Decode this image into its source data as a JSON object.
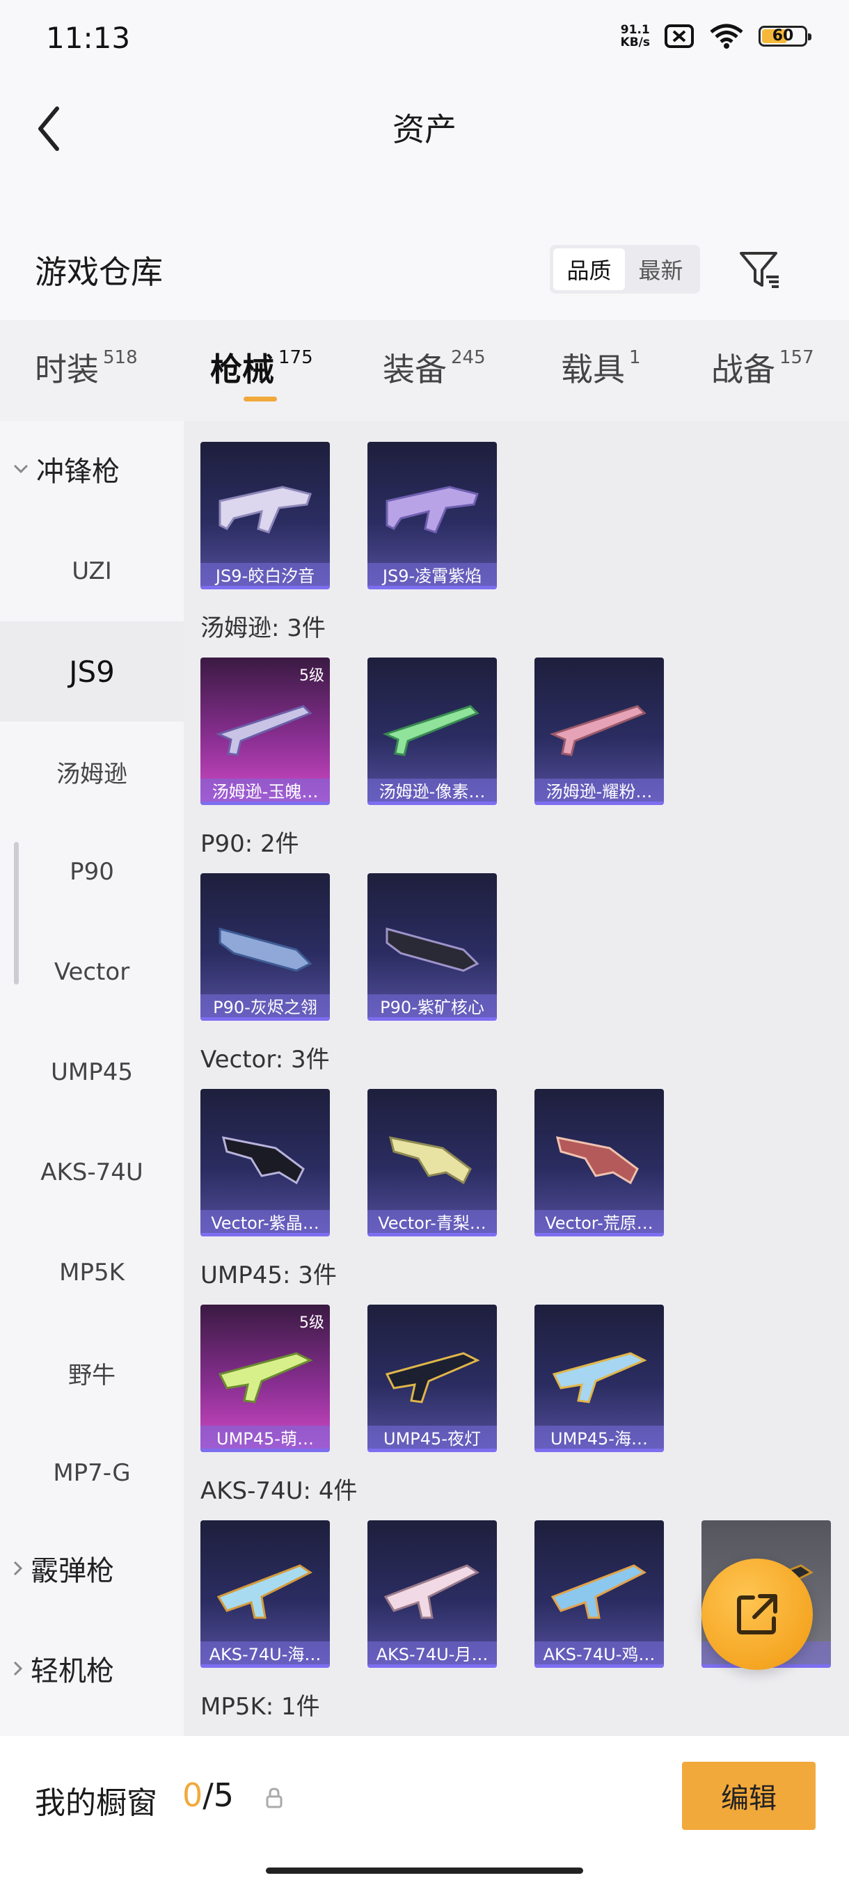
{
  "status_bar": {
    "time": "11:13",
    "net_speed_value": "91.1",
    "net_speed_unit": "KB/s",
    "battery": "60",
    "battery_level": 0.6
  },
  "header": {
    "title": "资产"
  },
  "warehouse": {
    "title": "游戏仓库",
    "sort_options": [
      "品质",
      "最新"
    ],
    "active_sort": "品质"
  },
  "tabs": [
    {
      "label": "时装",
      "count": "518"
    },
    {
      "label": "枪械",
      "count": "175",
      "active": true
    },
    {
      "label": "装备",
      "count": "245"
    },
    {
      "label": "载具",
      "count": "1"
    },
    {
      "label": "战备",
      "count": "157"
    }
  ],
  "sidebar": {
    "groups": [
      "冲锋枪",
      "霰弹枪",
      "轻机枪"
    ],
    "items": [
      "UZI",
      "JS9",
      "汤姆逊",
      "P90",
      "Vector",
      "UMP45",
      "AKS-74U",
      "MP5K",
      "野牛",
      "MP7-G"
    ],
    "selected": "JS9"
  },
  "content": {
    "groups": [
      {
        "label": "",
        "cards": [
          "JS9-皎白汐音",
          "JS9-凌霄紫焰"
        ]
      },
      {
        "label": "汤姆逊: 3件",
        "cards": [
          "汤姆逊-玉魄…",
          "汤姆逊-像素…",
          "汤姆逊-耀粉…"
        ]
      },
      {
        "label": "P90: 2件",
        "cards": [
          "P90-灰烬之翎",
          "P90-紫矿核心"
        ]
      },
      {
        "label": "Vector: 3件",
        "cards": [
          "Vector-紫晶…",
          "Vector-青梨…",
          "Vector-荒原…"
        ]
      },
      {
        "label": "UMP45: 3件",
        "cards": [
          "UMP45-萌…",
          "UMP45-夜灯",
          "UMP45-海…"
        ]
      },
      {
        "label": "AKS-74U: 4件",
        "cards": [
          "AKS-74U-海…",
          "AKS-74U-月…",
          "AKS-74U-鸡…",
          "…"
        ]
      },
      {
        "label": "MP5K: 1件",
        "cards": []
      }
    ],
    "level_badge": "5级"
  },
  "bottom_bar": {
    "showcase_label": "我的橱窗",
    "current": "0",
    "total": "/5",
    "edit_label": "编辑"
  }
}
